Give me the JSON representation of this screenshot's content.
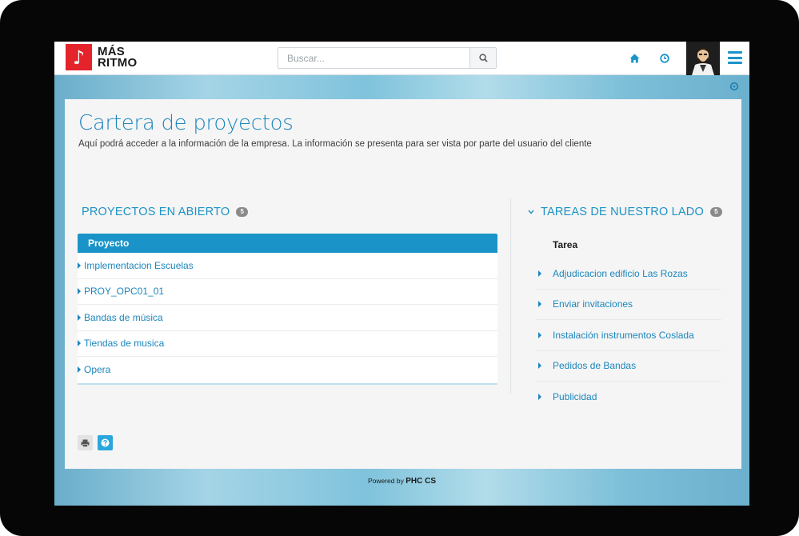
{
  "brand": {
    "line1": "MÁS",
    "line2": "RITMO",
    "icon": "music-note-icon",
    "color": "#e4232b"
  },
  "search": {
    "placeholder": "Buscar...",
    "value": ""
  },
  "header_icons": [
    "home-icon",
    "clock-icon",
    "avatar",
    "menu-icon"
  ],
  "page": {
    "title": "Cartera de proyectos",
    "subtitle": "Aquí podrá acceder a la información de la empresa. La información se presenta para ser vista por parte del usuario del cliente"
  },
  "projects": {
    "title": "PROYECTOS EN ABIERTO",
    "count": "5",
    "column": "Proyecto",
    "items": [
      "Implementacion Escuelas",
      "PROY_OPC01_01",
      "Bandas de música",
      "Tiendas de musica",
      "Opera"
    ]
  },
  "tasks": {
    "title": "TAREAS DE NUESTRO LADO",
    "count": "5",
    "column": "Tarea",
    "items": [
      "Adjudicacion edificio Las Rozas",
      "Enviar invitaciones",
      "Instalación instrumentos Coslada",
      "Pedidos de Bandas",
      "Publicidad"
    ]
  },
  "footer": {
    "prefix": "Powered by",
    "brand": "PHC CS"
  },
  "colors": {
    "accent": "#1a94c8",
    "link": "#1c86bd",
    "badge": "#8a8a8a"
  }
}
